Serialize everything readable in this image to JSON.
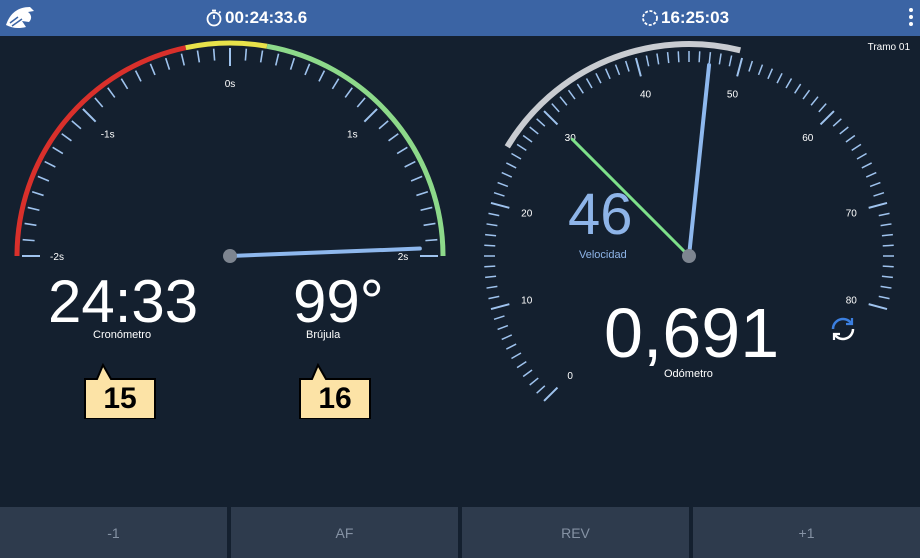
{
  "topbar": {
    "logo_icon": "eagle-logo-icon",
    "timer": "00:24:33.6",
    "timer_icon": "stopwatch-icon",
    "clock": "16:25:03",
    "clock_icon": "clock-icon",
    "menu_icon": "more-vert-icon"
  },
  "stage": {
    "label": "Tramo 01"
  },
  "offset_gauge": {
    "tick_labels": [
      "-2s",
      "-1s",
      "0s",
      "1s",
      "2s"
    ],
    "min": -2,
    "max": 2,
    "needle_value": 1.95,
    "colors": {
      "red": "#d9302b",
      "yellow": "#e8e24a",
      "green": "#8dd98a",
      "ticks": "#9fc3ee",
      "needle": "#8eb8ee"
    }
  },
  "chrono": {
    "value": "24:33",
    "label": "Cronómetro"
  },
  "compass": {
    "value": "99°",
    "label": "Brújula"
  },
  "callouts": {
    "left": "15",
    "right": "16"
  },
  "speedometer": {
    "tick_labels": [
      "0",
      "10",
      "20",
      "30",
      "40",
      "50",
      "60",
      "70",
      "80"
    ],
    "min": 0,
    "max": 80,
    "needle_value": 47,
    "target_value": 30,
    "value": "46",
    "label": "Velocidad",
    "colors": {
      "ticks": "#9fc3ee",
      "band": "#c9ccd1",
      "needle": "#8eb8ee",
      "target": "#7ee08a"
    }
  },
  "odometer": {
    "value": "0,691",
    "label": "Odómetro",
    "refresh_icon": "refresh-icon"
  },
  "buttons": {
    "minus": "-1",
    "af": "AF",
    "rev": "REV",
    "plus": "+1"
  }
}
